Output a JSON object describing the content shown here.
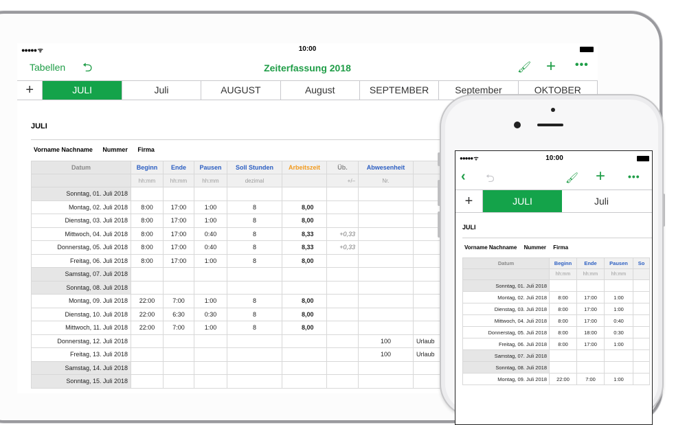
{
  "ipad": {
    "status": {
      "signal": "●●●●● ᯤ",
      "time": "10:00"
    },
    "nav": {
      "back_label": "Tabellen",
      "title": "Zeiterfassung 2018"
    },
    "tabs": [
      "JULI",
      "Juli",
      "AUGUST",
      "August",
      "SEPTEMBER",
      "September",
      "OKTOBER"
    ],
    "active_tab": 0,
    "sheet_title": "JULI",
    "meta": [
      "Vorname Nachname",
      "Nummer",
      "Firma"
    ],
    "columns": [
      {
        "label": "Datum",
        "sub": "",
        "color": "gray"
      },
      {
        "label": "Beginn",
        "sub": "hh:mm",
        "color": "blue"
      },
      {
        "label": "Ende",
        "sub": "hh:mm",
        "color": "blue"
      },
      {
        "label": "Pausen",
        "sub": "hh:mm",
        "color": "blue"
      },
      {
        "label": "Soll Stunden",
        "sub": "dezimal",
        "color": "blue"
      },
      {
        "label": "Arbeitszeit",
        "sub": "",
        "color": "orange"
      },
      {
        "label": "Üb.",
        "sub": "+/–",
        "color": "gray"
      },
      {
        "label": "Abwesenheit",
        "sub": "Nr.",
        "color": "blue"
      },
      {
        "label": "",
        "sub": "",
        "color": "gray"
      }
    ],
    "rows": [
      {
        "date": "Sonntag, 01. Juli 2018",
        "weekend": true,
        "cells": [
          "",
          "",
          "",
          "",
          "",
          "",
          "",
          ""
        ]
      },
      {
        "date": "Montag, 02. Juli 2018",
        "weekend": false,
        "cells": [
          "8:00",
          "17:00",
          "1:00",
          "8",
          "8,00",
          "",
          "",
          ""
        ]
      },
      {
        "date": "Dienstag, 03. Juli 2018",
        "weekend": false,
        "cells": [
          "8:00",
          "17:00",
          "1:00",
          "8",
          "8,00",
          "",
          "",
          ""
        ]
      },
      {
        "date": "Mittwoch, 04. Juli 2018",
        "weekend": false,
        "cells": [
          "8:00",
          "17:00",
          "0:40",
          "8",
          "8,33",
          "+0,33",
          "",
          ""
        ]
      },
      {
        "date": "Donnerstag, 05. Juli 2018",
        "weekend": false,
        "cells": [
          "8:00",
          "17:00",
          "0:40",
          "8",
          "8,33",
          "+0,33",
          "",
          ""
        ]
      },
      {
        "date": "Freitag, 06. Juli 2018",
        "weekend": false,
        "cells": [
          "8:00",
          "17:00",
          "1:00",
          "8",
          "8,00",
          "",
          "",
          ""
        ]
      },
      {
        "date": "Samstag, 07. Juli 2018",
        "weekend": true,
        "cells": [
          "",
          "",
          "",
          "",
          "",
          "",
          "",
          ""
        ]
      },
      {
        "date": "Sonntag, 08. Juli 2018",
        "weekend": true,
        "cells": [
          "",
          "",
          "",
          "",
          "",
          "",
          "",
          ""
        ]
      },
      {
        "date": "Montag, 09. Juli 2018",
        "weekend": false,
        "cells": [
          "22:00",
          "7:00",
          "1:00",
          "8",
          "8,00",
          "",
          "",
          ""
        ]
      },
      {
        "date": "Dienstag, 10. Juli 2018",
        "weekend": false,
        "cells": [
          "22:00",
          "6:30",
          "0:30",
          "8",
          "8,00",
          "",
          "",
          ""
        ]
      },
      {
        "date": "Mittwoch, 11. Juli 2018",
        "weekend": false,
        "cells": [
          "22:00",
          "7:00",
          "1:00",
          "8",
          "8,00",
          "",
          "",
          ""
        ]
      },
      {
        "date": "Donnerstag, 12. Juli 2018",
        "weekend": false,
        "cells": [
          "",
          "",
          "",
          "",
          "",
          "",
          "100",
          "Urlaub"
        ]
      },
      {
        "date": "Freitag, 13. Juli 2018",
        "weekend": false,
        "cells": [
          "",
          "",
          "",
          "",
          "",
          "",
          "100",
          "Urlaub"
        ]
      },
      {
        "date": "Samstag, 14. Juli 2018",
        "weekend": true,
        "cells": [
          "",
          "",
          "",
          "",
          "",
          "",
          "",
          ""
        ]
      },
      {
        "date": "Sonntag, 15. Juli 2018",
        "weekend": true,
        "cells": [
          "",
          "",
          "",
          "",
          "",
          "",
          "",
          ""
        ]
      }
    ]
  },
  "iphone": {
    "status": {
      "signal": "●●●●● ᯤ",
      "time": "10:00"
    },
    "tabs": [
      "JULI",
      "Juli"
    ],
    "active_tab": 0,
    "sheet_title": "JULI",
    "meta": [
      "Vorname Nachname",
      "Nummer",
      "Firma"
    ],
    "columns": [
      {
        "label": "Datum",
        "sub": "",
        "color": "gray"
      },
      {
        "label": "Beginn",
        "sub": "hh:mm",
        "color": "blue"
      },
      {
        "label": "Ende",
        "sub": "hh:mm",
        "color": "blue"
      },
      {
        "label": "Pausen",
        "sub": "hh:mm",
        "color": "blue"
      },
      {
        "label": "So",
        "sub": "",
        "color": "blue"
      }
    ],
    "rows": [
      {
        "date": "Sonntag, 01. Juli 2018",
        "weekend": true,
        "cells": [
          "",
          "",
          "",
          ""
        ]
      },
      {
        "date": "Montag, 02. Juli 2018",
        "weekend": false,
        "cells": [
          "8:00",
          "17:00",
          "1:00",
          ""
        ]
      },
      {
        "date": "Dienstag, 03. Juli 2018",
        "weekend": false,
        "cells": [
          "8:00",
          "17:00",
          "1:00",
          ""
        ]
      },
      {
        "date": "Mittwoch, 04. Juli 2018",
        "weekend": false,
        "cells": [
          "8:00",
          "17:00",
          "0:40",
          ""
        ]
      },
      {
        "date": "Donnerstag, 05. Juli 2018",
        "weekend": false,
        "cells": [
          "8:00",
          "18:00",
          "0:30",
          ""
        ]
      },
      {
        "date": "Freitag, 06. Juli 2018",
        "weekend": false,
        "cells": [
          "8:00",
          "17:00",
          "1:00",
          ""
        ]
      },
      {
        "date": "Samstag, 07. Juli 2018",
        "weekend": true,
        "cells": [
          "",
          "",
          "",
          ""
        ]
      },
      {
        "date": "Sonntag, 08. Juli 2018",
        "weekend": true,
        "cells": [
          "",
          "",
          "",
          ""
        ]
      },
      {
        "date": "Montag, 09. Juli 2018",
        "weekend": false,
        "cells": [
          "22:00",
          "7:00",
          "1:00",
          ""
        ]
      }
    ]
  },
  "colors": {
    "accent": "#14a34a",
    "accent_text": "#1f9d47",
    "header_blue": "#2b5ec2",
    "header_orange": "#f29a1d"
  },
  "icons": {
    "undo": "undo-icon",
    "brush": "brush-icon",
    "add": "plus-icon",
    "more": "more-icon",
    "back": "chevron-left-icon"
  }
}
